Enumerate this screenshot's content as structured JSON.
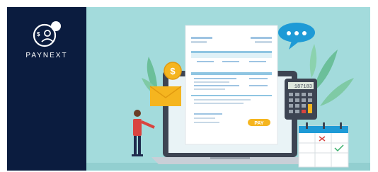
{
  "brand": {
    "name": "PAYNEXT",
    "logo_icon": "dollar-user-icon",
    "colors": {
      "panel": "#0b1c3f",
      "scene": "#a3dbdc",
      "accent": "#f5b51f"
    }
  },
  "invoice": {
    "pay_button_label": "PAY"
  },
  "calculator": {
    "display_value": "187183"
  },
  "chat_bubble": {
    "icon": "chat-dots-icon"
  },
  "icons": [
    "dollar-coin-icon",
    "envelope-icon",
    "calendar-icon",
    "plant-leaves-icon",
    "person-figure-icon",
    "laptop-icon"
  ]
}
